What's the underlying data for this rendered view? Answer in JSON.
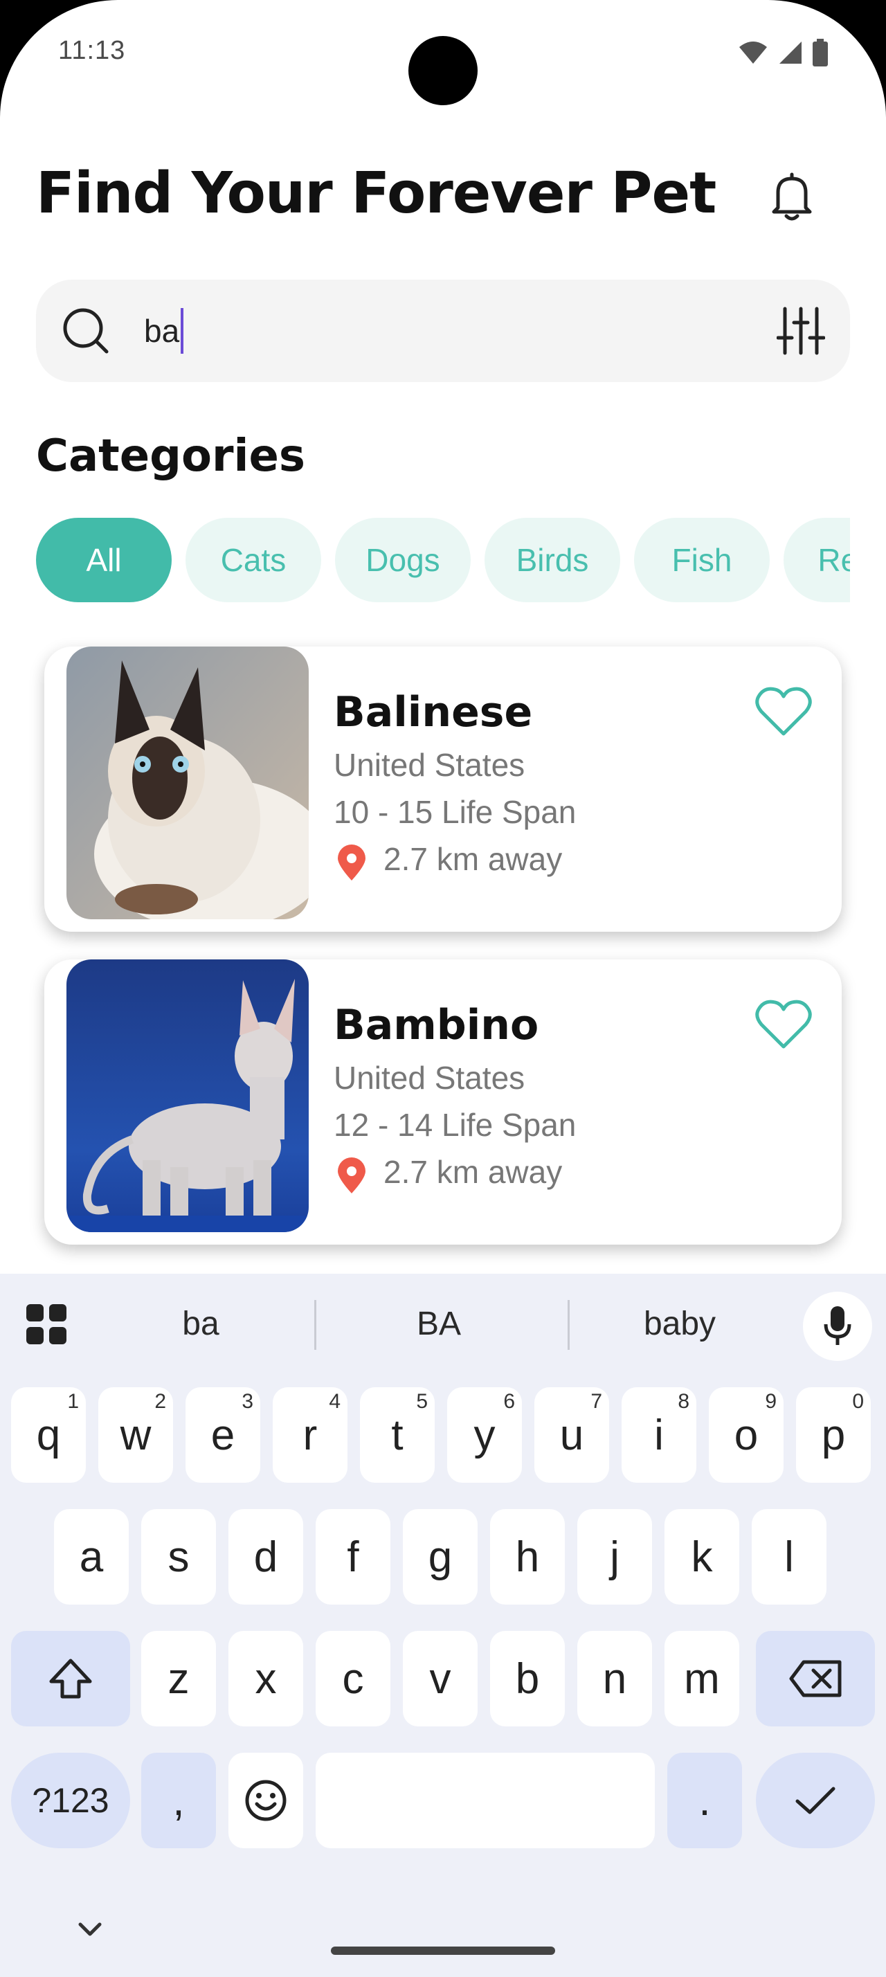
{
  "status_bar": {
    "time": "11:13"
  },
  "header": {
    "title": "Find Your Forever Pet"
  },
  "search": {
    "value": "ba"
  },
  "categories": {
    "title": "Categories",
    "items": [
      "All",
      "Cats",
      "Dogs",
      "Birds",
      "Fish",
      "Rept"
    ],
    "selected": "All"
  },
  "pets": [
    {
      "name": "Balinese",
      "origin": "United States",
      "life_span": "10 - 15 Life Span",
      "distance": "2.7 km away"
    },
    {
      "name": "Bambino",
      "origin": "United States",
      "life_span": "12 - 14 Life Span",
      "distance": "2.7 km away"
    }
  ],
  "keyboard": {
    "suggestions": [
      "ba",
      "BA",
      "baby"
    ],
    "row1": [
      "q",
      "w",
      "e",
      "r",
      "t",
      "y",
      "u",
      "i",
      "o",
      "p"
    ],
    "row1_hints": [
      "1",
      "2",
      "3",
      "4",
      "5",
      "6",
      "7",
      "8",
      "9",
      "0"
    ],
    "row2": [
      "a",
      "s",
      "d",
      "f",
      "g",
      "h",
      "j",
      "k",
      "l"
    ],
    "row3": [
      "z",
      "x",
      "c",
      "v",
      "b",
      "n",
      "m"
    ],
    "symbols_label": "?123",
    "comma": ",",
    "period": "."
  },
  "colors": {
    "accent": "#42bba9",
    "chip_bg": "#eaf7f4",
    "pin": "#ef5a4a",
    "caret": "#6b4bd6"
  }
}
